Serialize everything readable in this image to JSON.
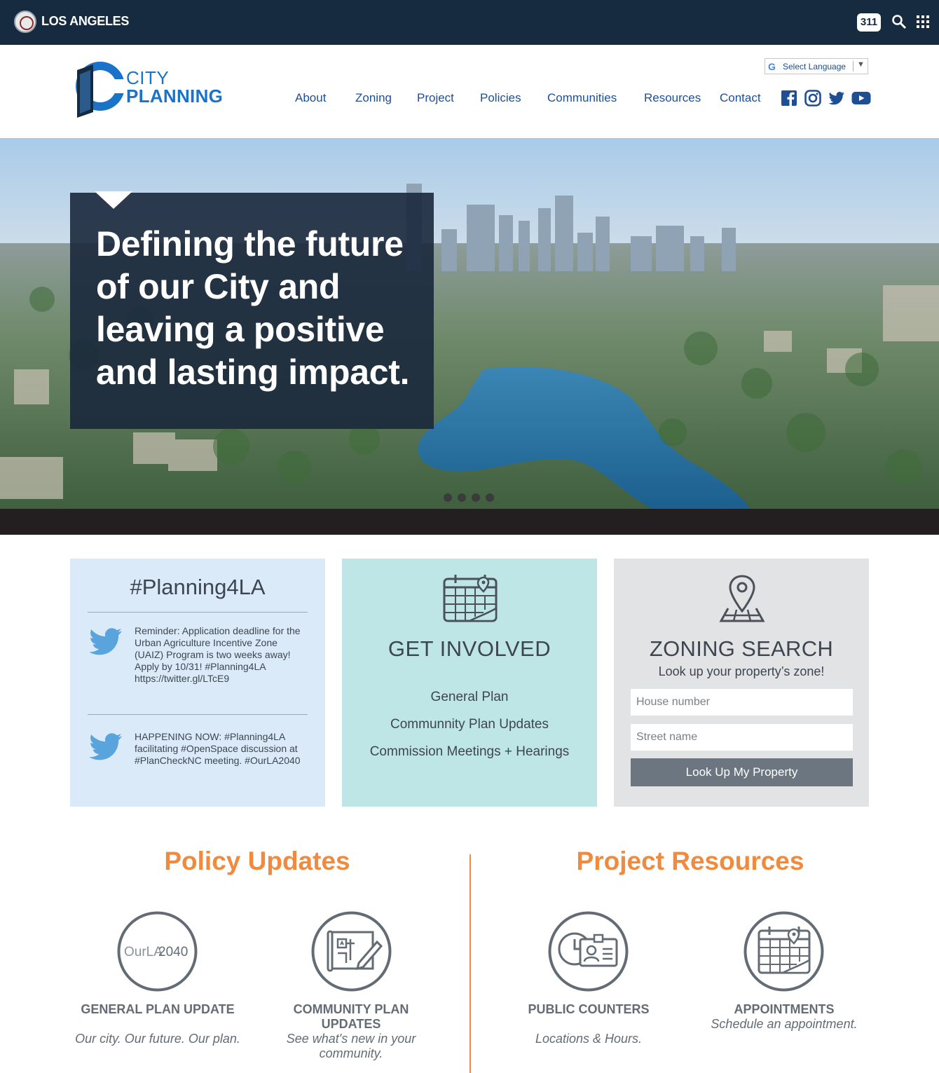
{
  "topbar": {
    "city_name": "LOS ANGELES",
    "btn_311": "311",
    "icons": [
      "la-seal-icon",
      "search-icon",
      "apps-grid-icon"
    ]
  },
  "header": {
    "logo_line1": "CITY",
    "logo_line2": "PLANNING",
    "language_select": "Select Language",
    "nav": [
      "About",
      "Zoning",
      "Project",
      "Policies",
      "Communities",
      "Resources",
      "Contact"
    ],
    "social_icons": [
      "facebook-icon",
      "instagram-icon",
      "twitter-icon",
      "youtube-icon"
    ]
  },
  "hero": {
    "headline": "Defining the future of our City and leaving a positive and lasting impact.",
    "slide_count": 4
  },
  "planning4la": {
    "title": "#Planning4LA",
    "tweets": [
      {
        "text": "Reminder: Application deadline for the Urban Agriculture Incentive Zone (UAIZ) Program is two weeks away! Apply by 10/31! #Planning4LA https://twitter.gl/LTcE9"
      },
      {
        "text": "HAPPENING NOW: #Planning4LA facilitating #OpenSpace discussion at #PlanCheckNC meeting. #OurLA2040"
      }
    ]
  },
  "get_involved": {
    "title": "GET INVOLVED",
    "links": [
      "General Plan",
      "Communnity Plan Updates",
      "Commission Meetings + Hearings"
    ]
  },
  "zoning_search": {
    "title": "ZONING SEARCH",
    "subtitle": "Look up your property’s zone!",
    "house_placeholder": "House number",
    "street_placeholder": "Street name",
    "button": "Look Up My Property"
  },
  "policy_updates": {
    "title": "Policy Updates",
    "items": [
      {
        "logo_text_a": "OurLA",
        "logo_text_b": "2040",
        "title": "GENERAL PLAN UPDATE",
        "subtitle": "Our city. Our future. Our plan."
      },
      {
        "title": "COMMUNITY PLAN UPDATES",
        "subtitle": "See what's new in your community."
      }
    ]
  },
  "project_resources": {
    "title": "Project Resources",
    "items": [
      {
        "title": "PUBLIC COUNTERS",
        "subtitle": "Locations & Hours."
      },
      {
        "title": "APPOINTMENTS",
        "subtitle": "Schedule an appointment."
      }
    ]
  },
  "colors": {
    "topbar": "#162b40",
    "brand_blue": "#1a73c9",
    "accent_orange": "#f08a3e",
    "card_blue": "#dbeaf8",
    "card_teal": "#bfe6e7",
    "card_gray": "#e2e3e5"
  }
}
